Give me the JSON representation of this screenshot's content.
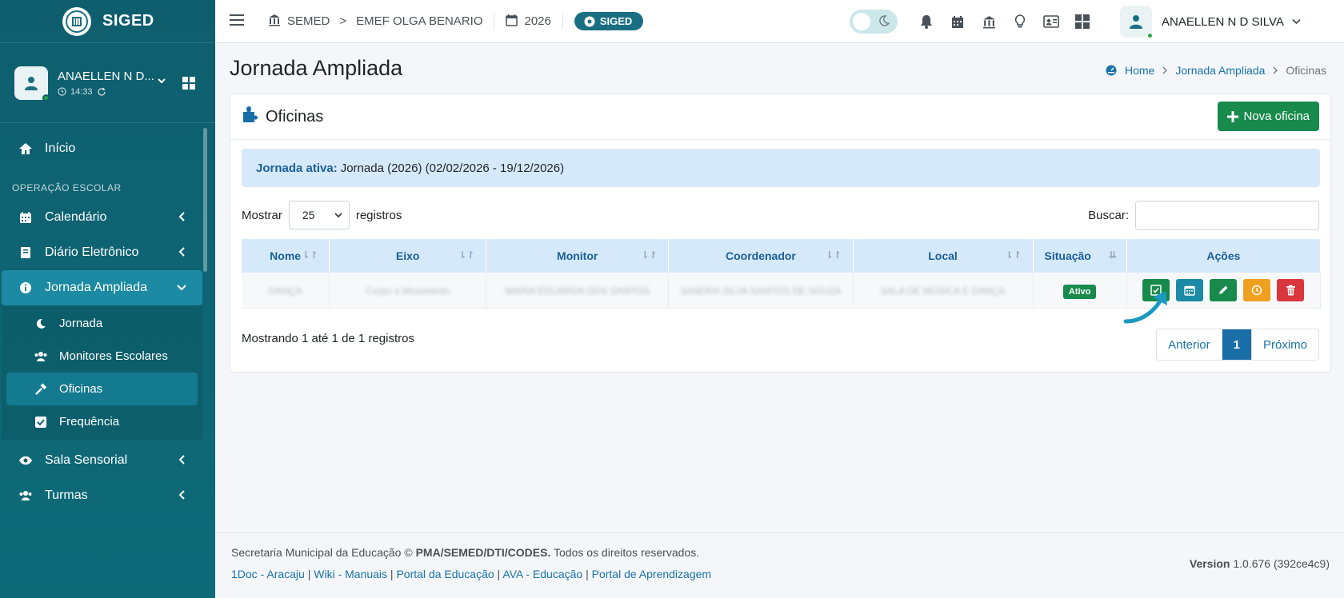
{
  "brand": {
    "name": "SIGED"
  },
  "user_panel": {
    "name": "ANAELLEN N D...",
    "time": "14:33"
  },
  "nav": {
    "inicio": "Início",
    "section": "OPERAÇÃO ESCOLAR",
    "calendario": "Calendário",
    "diario": "Diário Eletrônico",
    "jornada_ampliada": "Jornada Ampliada",
    "sub": {
      "jornada": "Jornada",
      "monitores": "Monitores Escolares",
      "oficinas": "Oficinas",
      "frequencia": "Frequência"
    },
    "sala": "Sala Sensorial",
    "turmas": "Turmas"
  },
  "topbar": {
    "semed": "SEMED",
    "sep": ">",
    "school": "EMEF OLGA BENARIO",
    "year": "2026",
    "badge": "SIGED",
    "user": "ANAELLEN N D SILVA"
  },
  "page": {
    "title": "Jornada Ampliada"
  },
  "breadcrumb": {
    "home": "Home",
    "section": "Jornada Ampliada",
    "current": "Oficinas"
  },
  "card": {
    "title": "Oficinas",
    "new_button": "Nova oficina"
  },
  "alert": {
    "label": "Jornada ativa:",
    "text": "Jornada (2026) (02/02/2026 - 19/12/2026)"
  },
  "table_controls": {
    "show": "Mostrar",
    "page_len": "25",
    "records": "registros",
    "search": "Buscar:"
  },
  "table": {
    "headers": [
      "Nome",
      "Eixo",
      "Monitor",
      "Coordenador",
      "Local",
      "Situação",
      "Ações"
    ],
    "rows": [
      {
        "nome": "DANÇA",
        "eixo": "Corpo e Movimento",
        "monitor": "MARIA EDUARDA DOS SANTOS",
        "coordenador": "SANDRA SILVA SANTOS DE SOUZA",
        "local": "SALA DE MÚSICA E DANÇA",
        "situacao": "Ativo"
      }
    ]
  },
  "info": "Mostrando 1 até 1 de 1 registros",
  "pagination": {
    "prev": "Anterior",
    "page": "1",
    "next": "Próximo"
  },
  "footer": {
    "copyright_pre": "Secretaria Municipal da Educação ©",
    "copyright_org": "PMA/SEMED/DTI/CODES.",
    "copyright_post": "Todos os direitos reservados.",
    "links": [
      "1Doc - Aracaju",
      "Wiki - Manuais",
      "Portal da Educação",
      "AVA - Educação",
      "Portal de Aprendizagem"
    ],
    "version_label": "Version",
    "version": "1.0.676 (392ce4c9)"
  },
  "colors": {
    "sidebar": "#0f5e6e",
    "accent": "#1a6e82",
    "success": "#178a4c",
    "warning": "#f0a020",
    "danger": "#d9363e"
  }
}
